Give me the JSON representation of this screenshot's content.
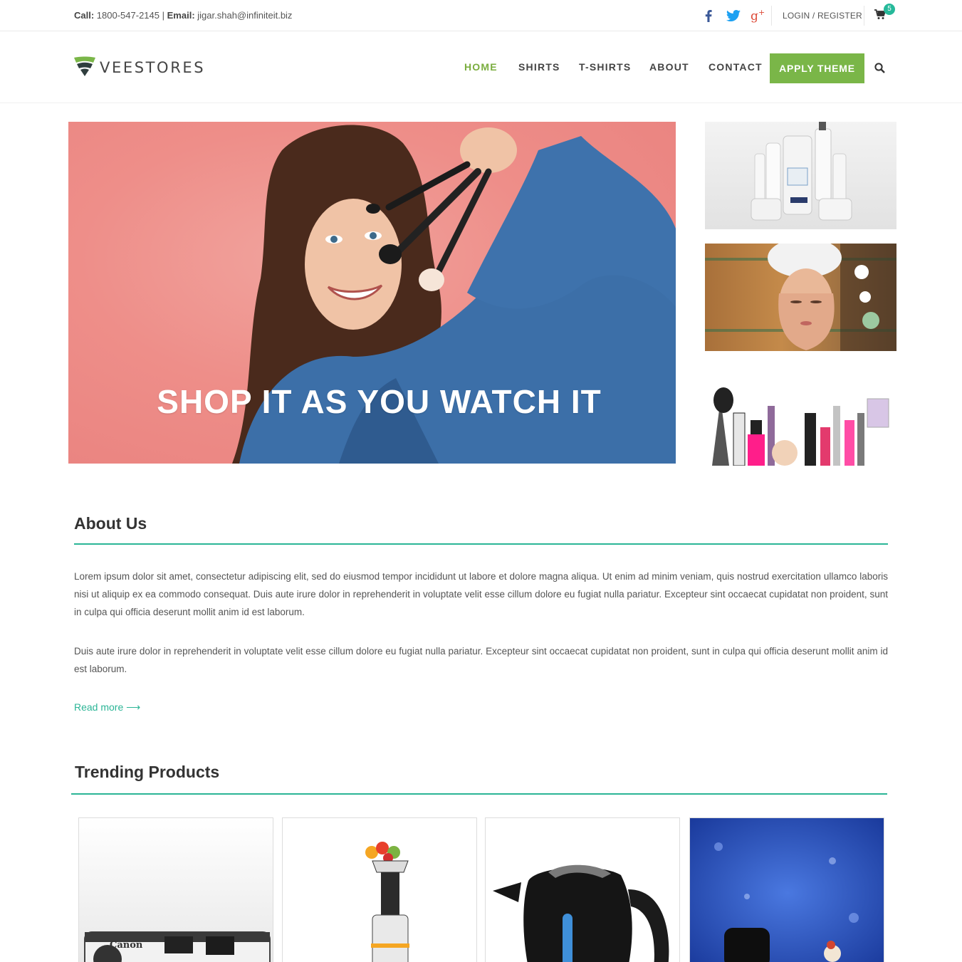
{
  "topbar": {
    "call_label": "Call:",
    "phone": "1800-547-2145",
    "separator": "|",
    "email_label": "Email:",
    "email": "jigar.shah@infiniteit.biz",
    "social_icons": [
      "facebook-icon",
      "twitter-icon",
      "google-plus-icon"
    ],
    "login_label": "LOGIN / REGISTER",
    "cart_count": "5"
  },
  "header": {
    "logo_text": "VEESTORES",
    "nav": [
      "HOME",
      "SHIRTS",
      "T-SHIRTS",
      "ABOUT",
      "CONTACT"
    ],
    "active_nav": "HOME",
    "apply_button": "APPLY THEME"
  },
  "hero": {
    "caption": "SHOP IT AS YOU WATCH IT"
  },
  "about": {
    "title": "About Us",
    "paragraph1": "Lorem ipsum dolor sit amet, consectetur adipiscing elit, sed do eiusmod tempor incididunt ut labore et dolore magna aliqua. Ut enim ad minim veniam, quis nostrud exercitation ullamco laboris nisi ut aliquip ex ea commodo consequat. Duis aute irure dolor in reprehenderit in voluptate velit esse cillum dolore eu fugiat nulla pariatur. Excepteur sint occaecat cupidatat non proident, sunt in culpa qui officia deserunt mollit anim id est laborum.",
    "paragraph2": "Duis aute irure dolor in reprehenderit in voluptate velit esse cillum dolore eu fugiat nulla pariatur. Excepteur sint occaecat cupidatat non proident, sunt in culpa qui officia deserunt mollit anim id est laborum.",
    "read_more": "Read more ⟶"
  },
  "trending": {
    "title": "Trending Products",
    "camera_brand": "Canon"
  },
  "colors": {
    "accent_green": "#7ab648",
    "nav_active": "#7aad3e",
    "teal": "#2bb596",
    "facebook": "#3b5998",
    "twitter": "#1da1f2",
    "google_plus": "#dd4b39"
  }
}
